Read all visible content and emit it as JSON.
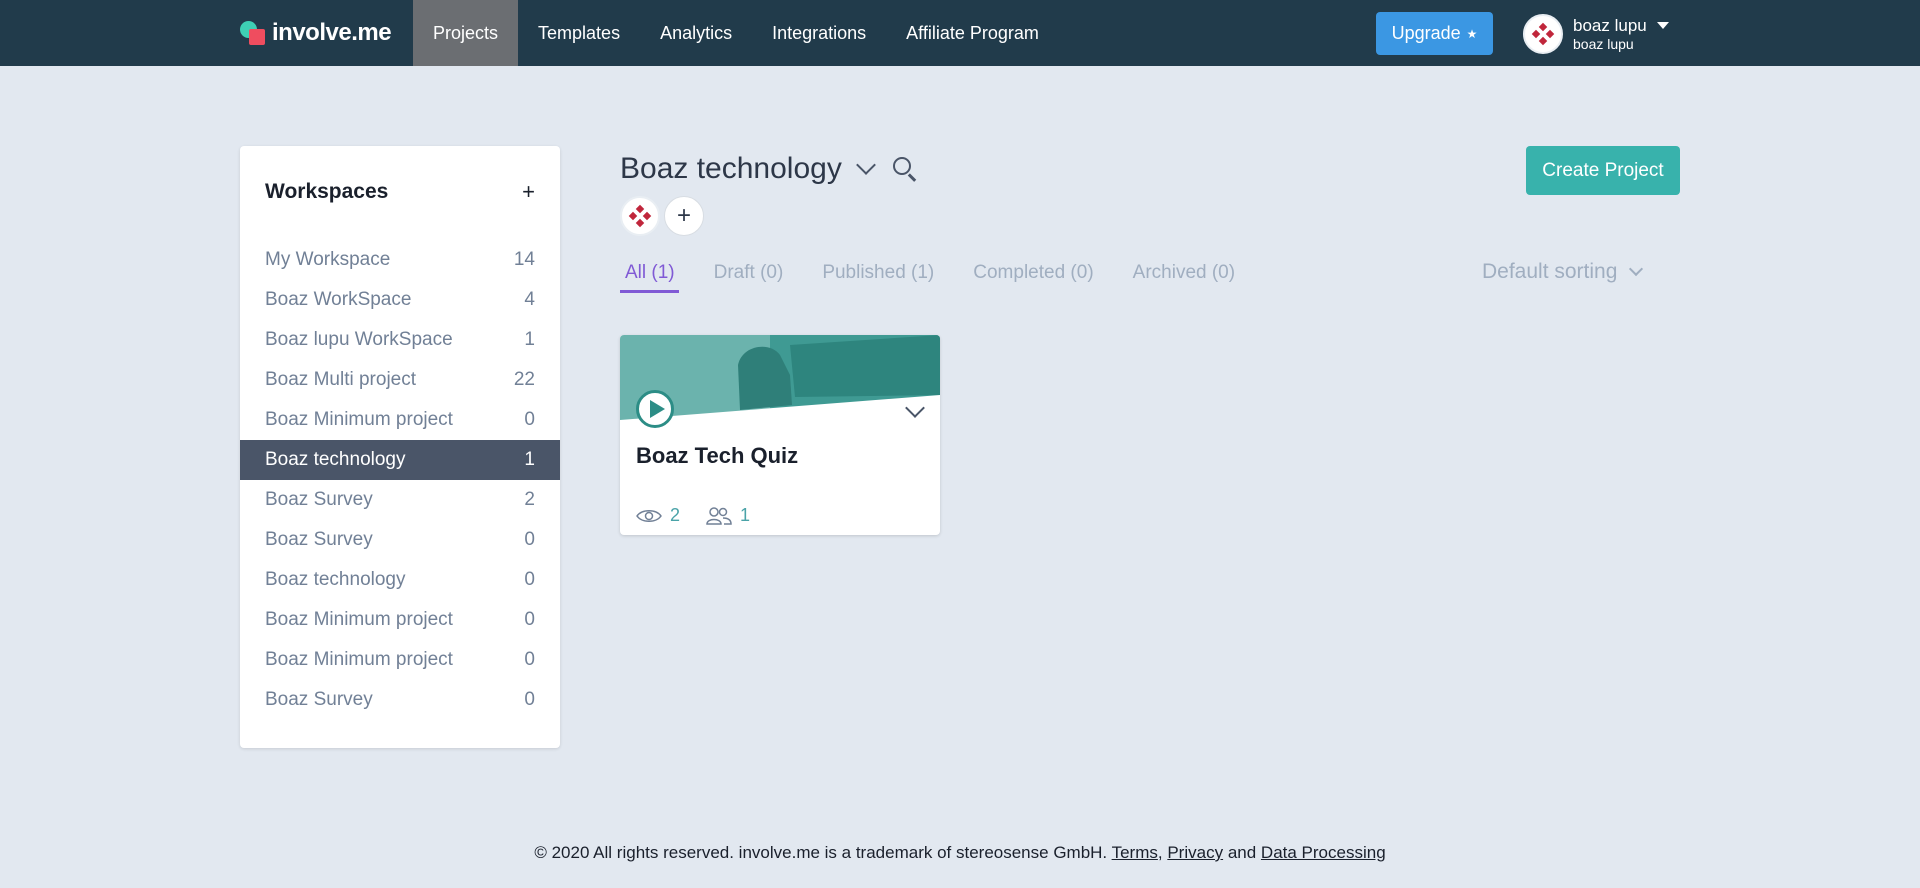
{
  "brand": {
    "name": "involve.me"
  },
  "nav": {
    "items": [
      {
        "label": "Projects",
        "active": true
      },
      {
        "label": "Templates"
      },
      {
        "label": "Analytics"
      },
      {
        "label": "Integrations"
      },
      {
        "label": "Affiliate Program"
      }
    ],
    "upgrade_label": "Upgrade",
    "upgrade_icon": "★",
    "user": {
      "name": "boaz lupu",
      "workspace": "boaz lupu"
    }
  },
  "sidebar": {
    "title": "Workspaces",
    "add_icon": "+",
    "items": [
      {
        "label": "My Workspace",
        "count": "14"
      },
      {
        "label": "Boaz WorkSpace",
        "count": "4"
      },
      {
        "label": "Boaz lupu WorkSpace",
        "count": "1"
      },
      {
        "label": "Boaz Multi project",
        "count": "22"
      },
      {
        "label": "Boaz Minimum project",
        "count": "0"
      },
      {
        "label": "Boaz technology",
        "count": "1",
        "active": true
      },
      {
        "label": "Boaz Survey",
        "count": "2"
      },
      {
        "label": "Boaz Survey",
        "count": "0"
      },
      {
        "label": "Boaz technology",
        "count": "0"
      },
      {
        "label": "Boaz Minimum project",
        "count": "0"
      },
      {
        "label": "Boaz Minimum project",
        "count": "0"
      },
      {
        "label": "Boaz Survey",
        "count": "0"
      }
    ]
  },
  "main": {
    "workspace_title": "Boaz technology",
    "add_member_icon": "+",
    "create_label": "Create Project",
    "tabs": [
      {
        "label": "All (1)",
        "active": true
      },
      {
        "label": "Draft (0)"
      },
      {
        "label": "Published (1)"
      },
      {
        "label": "Completed (0)"
      },
      {
        "label": "Archived (0)"
      }
    ],
    "sorting": "Default sorting",
    "projects": [
      {
        "title": "Boaz Tech Quiz",
        "views": "2",
        "participants": "1"
      }
    ]
  },
  "footer": {
    "text": "© 2020 All rights reserved. involve.me is a trademark of stereosense GmbH.",
    "terms": "Terms",
    "sep": ",",
    "privacy": "Privacy",
    "and": "and",
    "data_processing": "Data Processing"
  },
  "colors": {
    "nav_bg": "#213b4b",
    "page_bg": "#e2e8f0",
    "accent_teal": "#38b2ac",
    "upgrade_blue": "#3b97e3",
    "tab_active": "#805ad5",
    "sidebar_active": "#4a5568"
  }
}
